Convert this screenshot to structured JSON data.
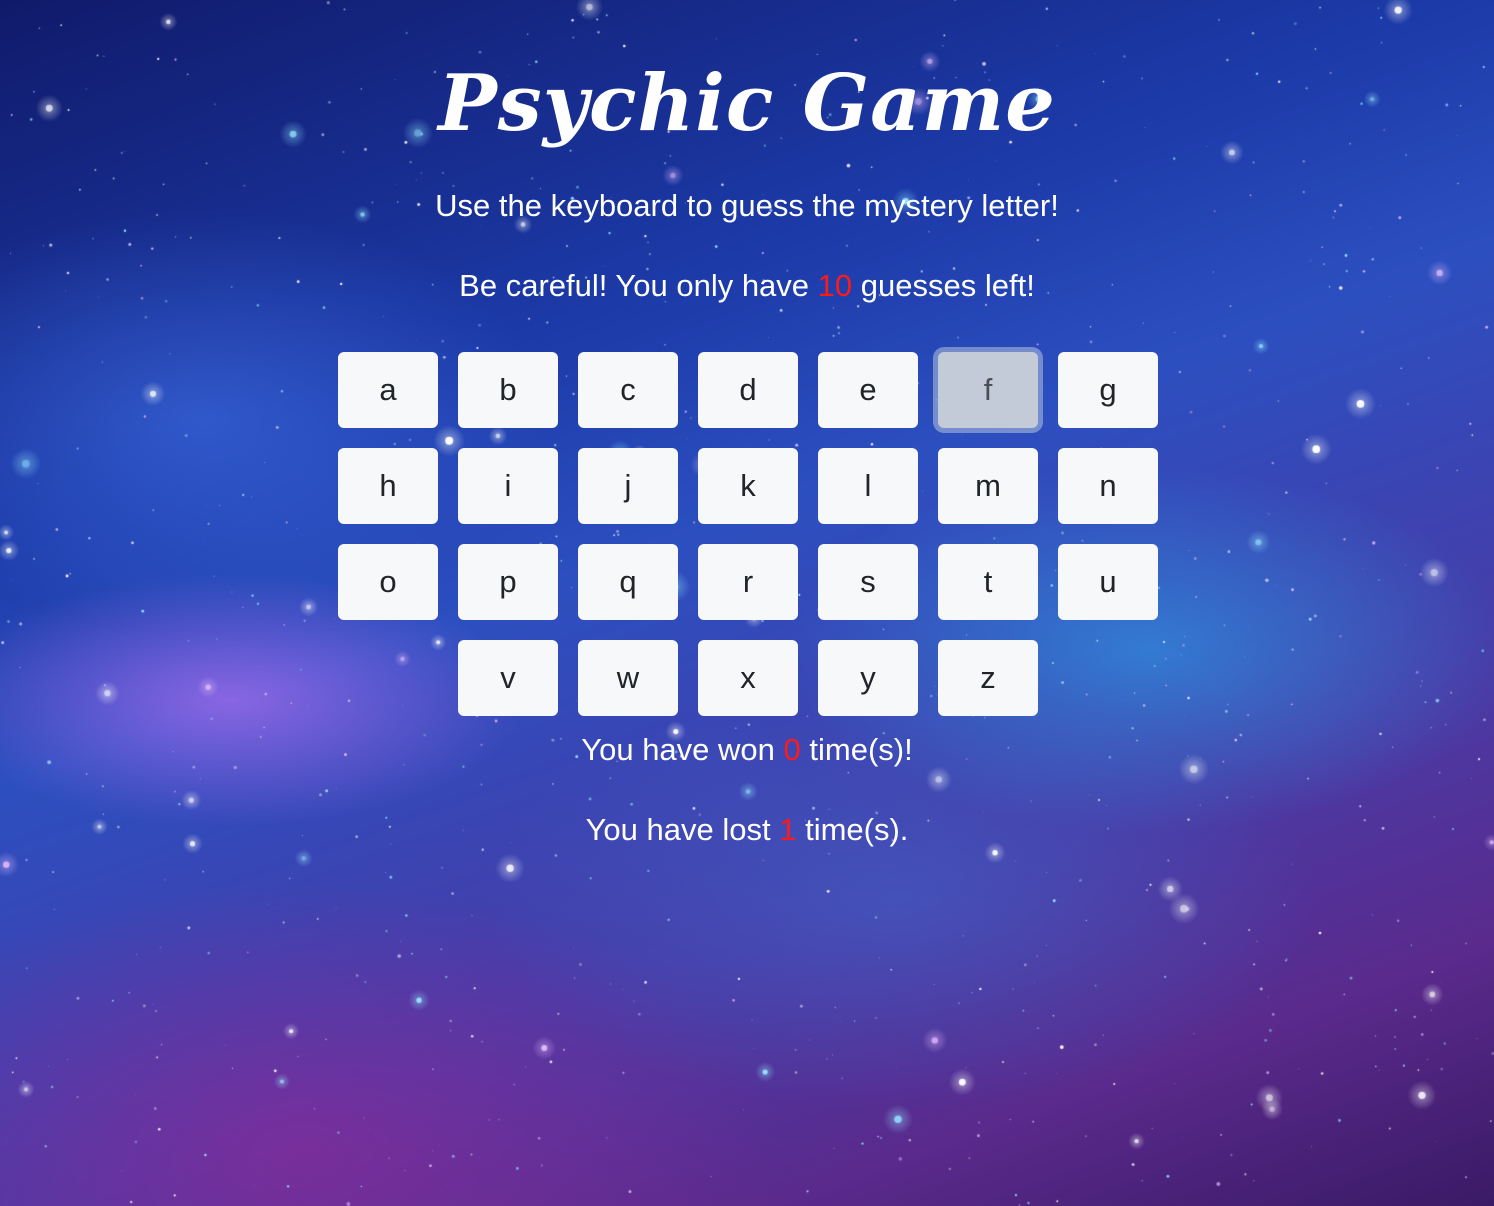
{
  "title": "Psychic Game",
  "instruction": "Use the keyboard to guess the mystery letter!",
  "guesses": {
    "prefix": "Be careful! You only have",
    "count": "10",
    "suffix": "guesses left!"
  },
  "keys": [
    "a",
    "b",
    "c",
    "d",
    "e",
    "f",
    "g",
    "h",
    "i",
    "j",
    "k",
    "l",
    "m",
    "n",
    "o",
    "p",
    "q",
    "r",
    "s",
    "t",
    "u",
    "v",
    "w",
    "x",
    "y",
    "z"
  ],
  "active_key": "f",
  "wins": {
    "prefix": "You have won",
    "count": "0",
    "suffix": "time(s)!"
  },
  "losses": {
    "prefix": "You have lost",
    "count": "1",
    "suffix": "time(s)."
  },
  "colors": {
    "highlight": "#ff1a1a",
    "key_bg": "#f7f8fa",
    "key_active_bg": "#c3cbd9"
  }
}
